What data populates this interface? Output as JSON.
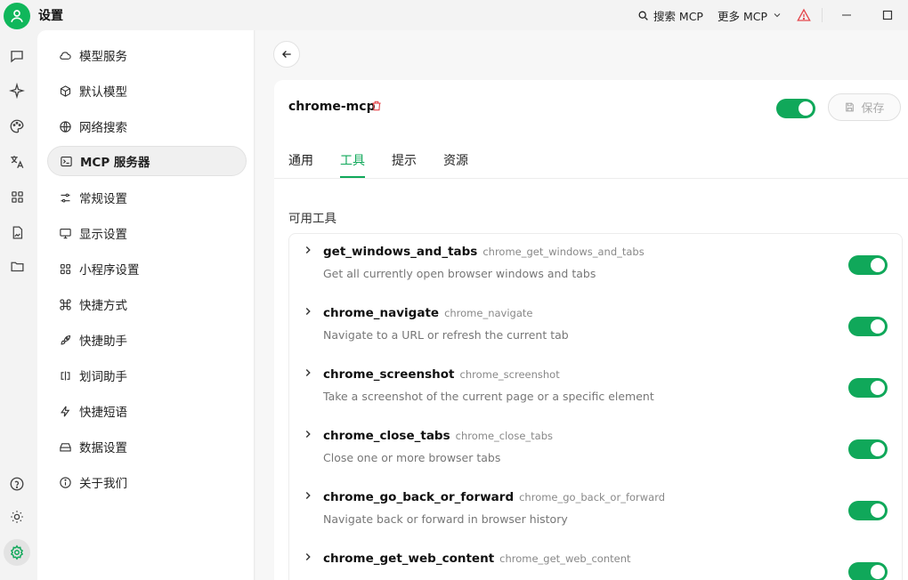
{
  "app": {
    "title": "设置"
  },
  "titlebar": {
    "search_label": "搜索 MCP",
    "more_label": "更多 MCP"
  },
  "menu": {
    "items": [
      {
        "label": "模型服务",
        "icon": "cloud-icon"
      },
      {
        "label": "默认模型",
        "icon": "cube-icon"
      },
      {
        "label": "网络搜索",
        "icon": "globe-icon"
      },
      {
        "label": "MCP 服务器",
        "icon": "terminal-icon",
        "active": true
      },
      {
        "label": "常规设置",
        "icon": "sliders-icon"
      },
      {
        "label": "显示设置",
        "icon": "monitor-icon"
      },
      {
        "label": "小程序设置",
        "icon": "grid-icon"
      },
      {
        "label": "快捷方式",
        "icon": "command-icon"
      },
      {
        "label": "快捷助手",
        "icon": "rocket-icon"
      },
      {
        "label": "划词助手",
        "icon": "text-select-icon"
      },
      {
        "label": "快捷短语",
        "icon": "zap-icon"
      },
      {
        "label": "数据设置",
        "icon": "hard-drive-icon"
      },
      {
        "label": "关于我们",
        "icon": "info-icon"
      }
    ]
  },
  "server": {
    "name": "chrome-mcp",
    "enabled": true,
    "save_label": "保存"
  },
  "tabs": [
    {
      "label": "通用"
    },
    {
      "label": "工具",
      "active": true
    },
    {
      "label": "提示"
    },
    {
      "label": "资源"
    }
  ],
  "section_title": "可用工具",
  "tools": [
    {
      "name": "get_windows_and_tabs",
      "id": "chrome_get_windows_and_tabs",
      "desc": "Get all currently open browser windows and tabs",
      "enabled": true
    },
    {
      "name": "chrome_navigate",
      "id": "chrome_navigate",
      "desc": "Navigate to a URL or refresh the current tab",
      "enabled": true
    },
    {
      "name": "chrome_screenshot",
      "id": "chrome_screenshot",
      "desc": "Take a screenshot of the current page or a specific element",
      "enabled": true
    },
    {
      "name": "chrome_close_tabs",
      "id": "chrome_close_tabs",
      "desc": "Close one or more browser tabs",
      "enabled": true
    },
    {
      "name": "chrome_go_back_or_forward",
      "id": "chrome_go_back_or_forward",
      "desc": "Navigate back or forward in browser history",
      "enabled": true
    },
    {
      "name": "chrome_get_web_content",
      "id": "chrome_get_web_content",
      "desc": "",
      "enabled": true
    }
  ],
  "colors": {
    "accent": "#10a85a",
    "warning": "#e5484d"
  }
}
